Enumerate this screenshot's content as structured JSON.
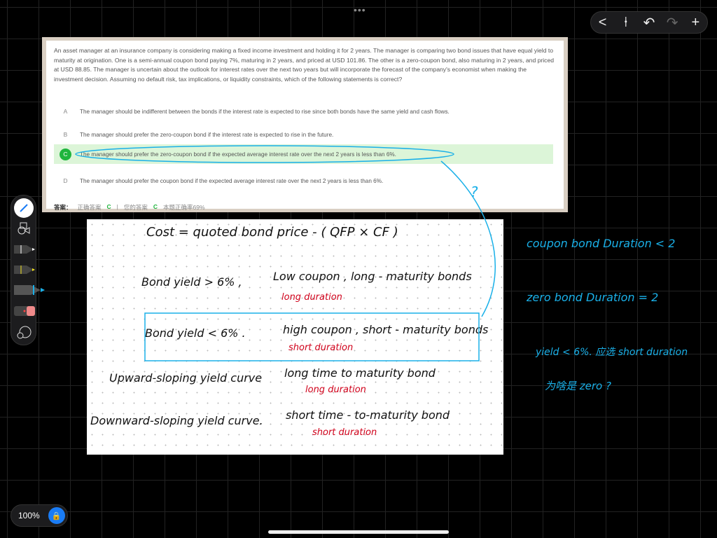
{
  "top_toolbar": {
    "back": "<",
    "pin": "⍿",
    "undo": "↶",
    "redo": "↷",
    "add": "+"
  },
  "question": {
    "text": "An asset manager at an insurance company is considering making a fixed income investment and holding it for 2 years. The manager is comparing two bond issues that have equal yield to maturity at origination. One is a semi-annual coupon bond paying 7%, maturing in 2 years, and priced at USD 101.86. The other is a zero-coupon bond, also maturing in 2 years, and priced at USD 88.85. The manager is uncertain about the outlook for interest rates over the next two years but will incorporate the forecast of the company's economist when making the investment decision. Assuming no default risk, tax implications, or liquidity constraints, which of the following statements is correct?",
    "options": [
      {
        "letter": "A",
        "text": "The manager should be indifferent between the bonds if the interest rate is expected to rise since both bonds have the same yield and cash flows."
      },
      {
        "letter": "B",
        "text": "The manager should prefer the zero-coupon bond if the interest rate is expected to rise in the future."
      },
      {
        "letter": "C",
        "text": "The manager should prefer the zero-coupon bond if the expected average interest rate over the next 2 years is less than 6%."
      },
      {
        "letter": "D",
        "text": "The manager should prefer the coupon bond if the expected average interest rate over the next 2 years is less than 6%."
      }
    ],
    "answer_label": "答案：",
    "correct_label": "正确答案",
    "correct": "C",
    "sep": "|",
    "yours_label": "您的答案",
    "yours": "C",
    "rate": "本题正确率69%"
  },
  "notes": {
    "l1": "Cost = quoted  bond price - ( QFP × CF )",
    "l2a": "Bond yield > 6% ,",
    "l2b": "Low coupon , long - maturity bonds",
    "l2c": "long duration",
    "l3a": "Bond yield < 6% .",
    "l3b": "high coupon , short - maturity bonds",
    "l3c": "short duration",
    "l4a": "Upward-sloping yield curve",
    "l4b": "long time to maturity bond",
    "l4c": "long duration",
    "l5a": "Downward-sloping yield curve.",
    "l5b": "short time - to-maturity bond",
    "l5c": "short duration"
  },
  "side_notes": {
    "q": "?",
    "s1": "coupon bond   Duration < 2",
    "s2": "zero bond   Duration = 2",
    "s3": "yield < 6%. 应选 short duration",
    "s4": "为啥是 zero ?"
  },
  "zoom": {
    "level": "100%",
    "lock": "🔒"
  }
}
